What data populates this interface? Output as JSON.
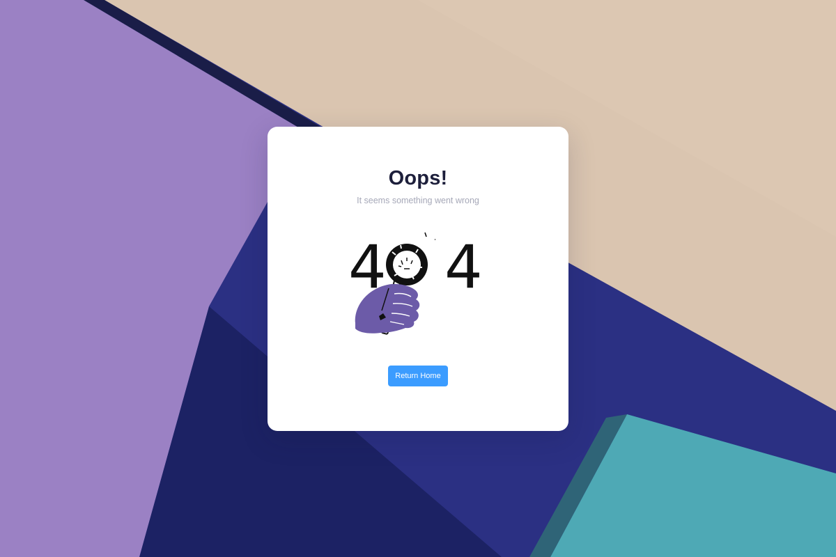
{
  "error_page": {
    "title": "Oops!",
    "subtitle": "It seems something went wrong",
    "code_left_digit": "4",
    "code_right_digit": "4",
    "button_label": "Return Home"
  },
  "colors": {
    "accent": "#3b9cff",
    "title": "#1d1f3b",
    "subtitle": "#a6a8b8",
    "hand": "#6c5ba8"
  },
  "icons": [
    "magnifying-glass-icon",
    "hand-icon"
  ]
}
